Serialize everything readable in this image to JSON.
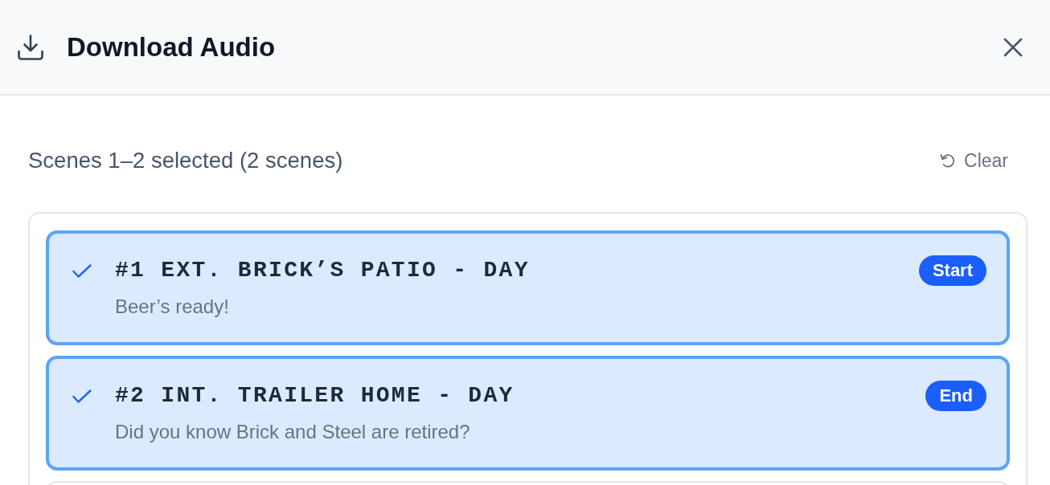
{
  "dialog": {
    "title": "Download Audio"
  },
  "selection": {
    "summary": "Scenes 1–2 selected (2 scenes)",
    "clear_label": "Clear"
  },
  "scenes": [
    {
      "heading": "#1 EXT. BRICK’S PATIO - DAY",
      "synopsis": "Beer’s ready!",
      "badge": "Start",
      "selected": true
    },
    {
      "heading": "#2 INT. TRAILER HOME - DAY",
      "synopsis": "Did you know Brick and Steel are retired?",
      "badge": "End",
      "selected": true
    },
    {
      "selected": false
    }
  ]
}
